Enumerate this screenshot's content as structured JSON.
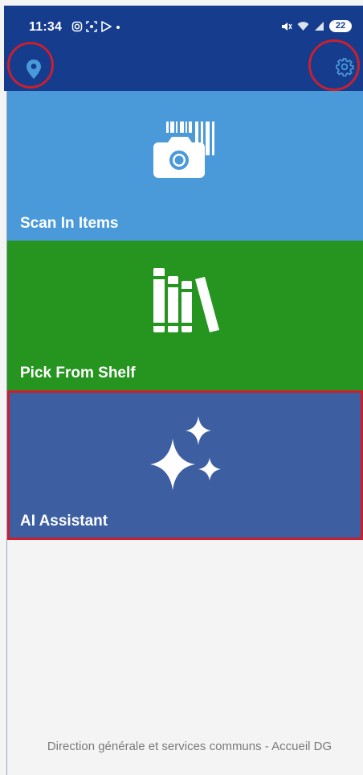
{
  "status_bar": {
    "time": "11:34",
    "battery": "22"
  },
  "toolbar": {
    "location_icon": "location-pin-icon",
    "settings_icon": "gear-icon"
  },
  "tiles": [
    {
      "label": "Scan In Items",
      "icon": "camera-barcode-icon",
      "color": "#4a9ad9"
    },
    {
      "label": "Pick From Shelf",
      "icon": "books-icon",
      "color": "#25951f"
    },
    {
      "label": "AI Assistant",
      "icon": "sparkles-icon",
      "color": "#3d5fa1"
    }
  ],
  "footer": {
    "location_name": "Direction générale et services communs - Accueil DG"
  },
  "colors": {
    "header": "#163c8e",
    "highlight": "#c8202e"
  }
}
